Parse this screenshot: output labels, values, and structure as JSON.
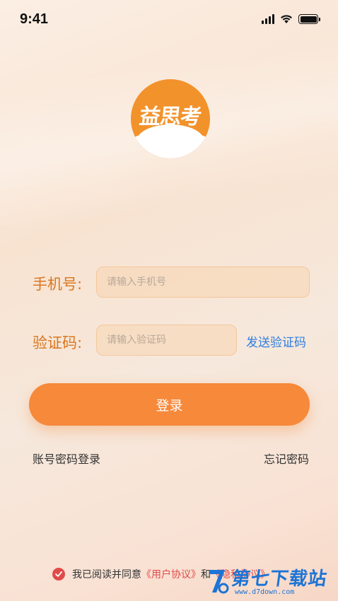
{
  "status_bar": {
    "time": "9:41"
  },
  "logo": {
    "text": "益思考",
    "brand_color": "#f2922b"
  },
  "form": {
    "phone_label": "手机号:",
    "phone_placeholder": "请输入手机号",
    "code_label": "验证码:",
    "code_placeholder": "请输入验证码",
    "send_code_label": "发送验证码"
  },
  "login_button": {
    "label": "登录",
    "color": "#f6893a"
  },
  "links": {
    "password_login": "账号密码登录",
    "forgot_password": "忘记密码"
  },
  "agreement": {
    "prefix": "我已阅读并同意",
    "user_agreement": "《用户协议》",
    "conjunction": "和",
    "privacy_agreement": "《隐私协议》",
    "checked": true
  },
  "watermark": {
    "title": "第七下载站",
    "url": "www.d7down.com"
  }
}
